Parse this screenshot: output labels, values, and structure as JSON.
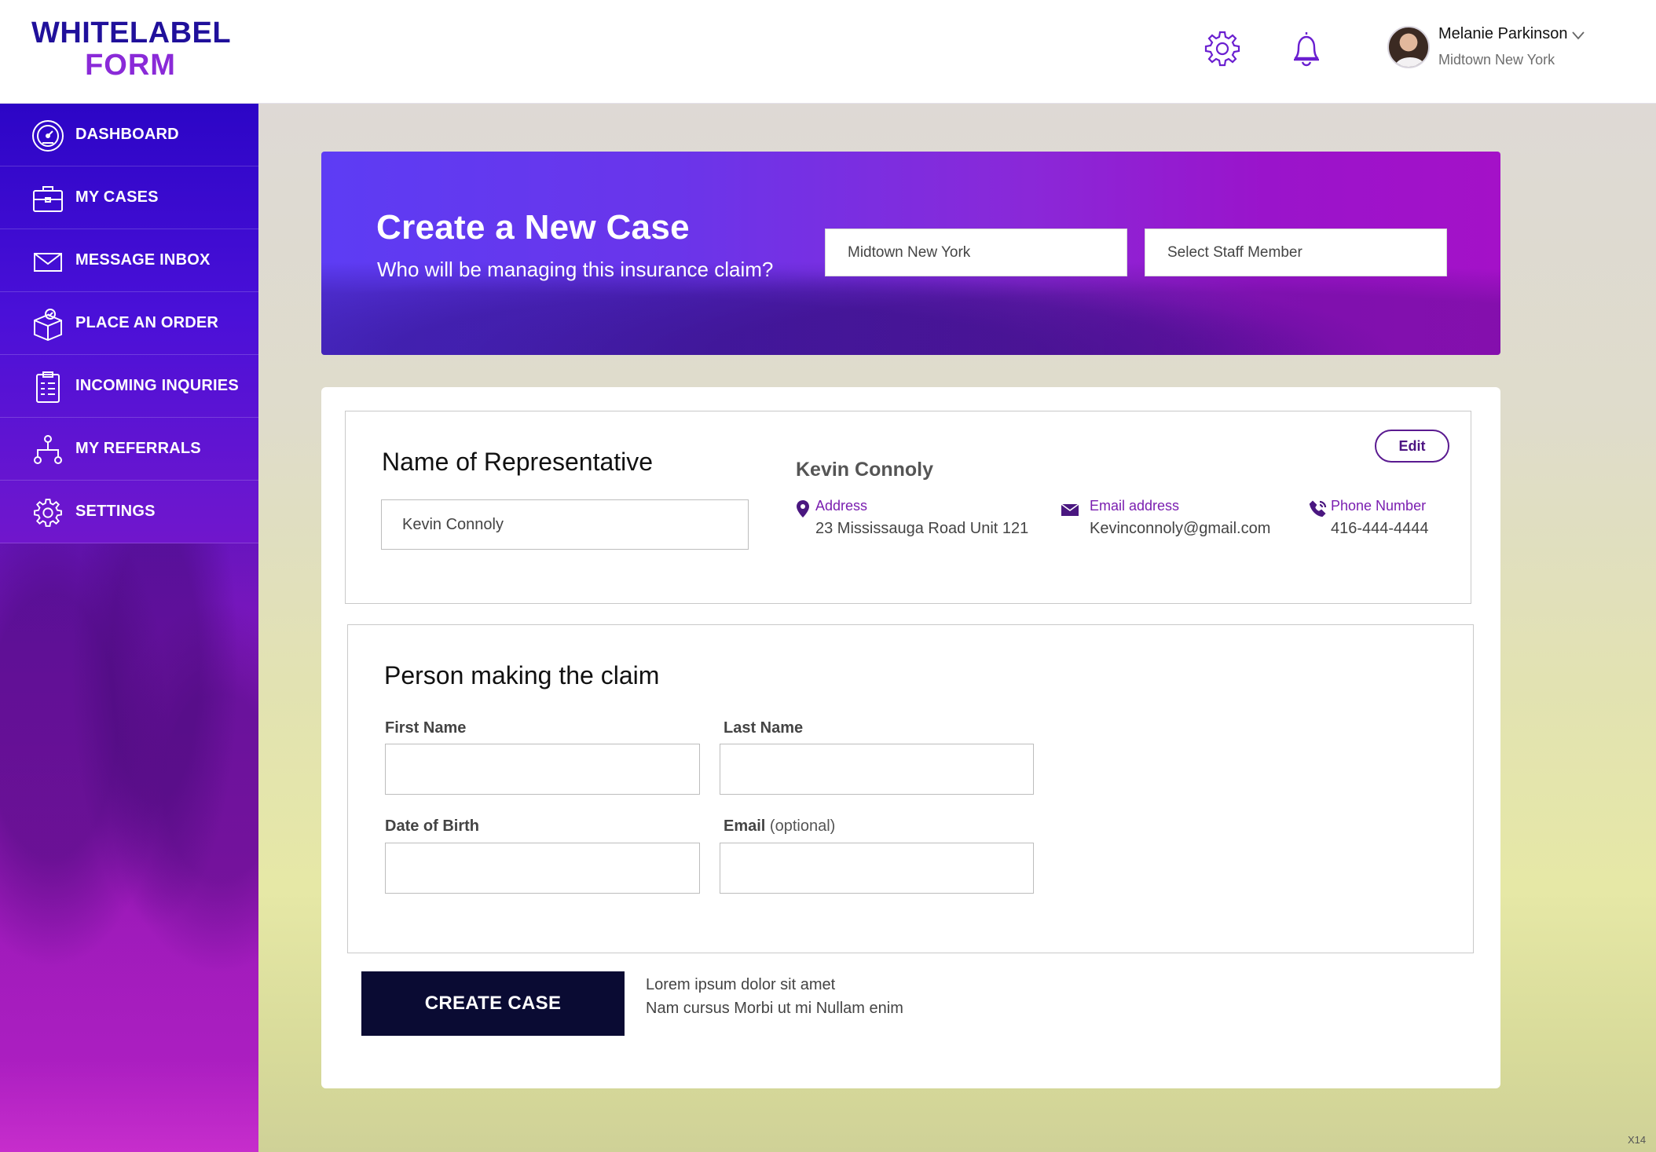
{
  "brand": {
    "line1": "WHITELABEL",
    "line2": "FORM"
  },
  "header": {
    "settings_icon": "gear-icon",
    "notifications_icon": "bell-icon",
    "user": {
      "name": "Melanie Parkinson",
      "location": "Midtown New York"
    }
  },
  "sidebar": {
    "items": [
      {
        "label": "DASHBOARD",
        "icon": "speedometer-icon"
      },
      {
        "label": "MY CASES",
        "icon": "briefcase-icon"
      },
      {
        "label": "MESSAGE INBOX",
        "icon": "envelope-icon"
      },
      {
        "label": "PLACE AN ORDER",
        "icon": "box-check-icon"
      },
      {
        "label": "INCOMING INQURIES",
        "icon": "clipboard-icon"
      },
      {
        "label": "MY REFERRALS",
        "icon": "network-icon"
      },
      {
        "label": "SETTINGS",
        "icon": "gear-icon"
      }
    ]
  },
  "banner": {
    "title": "Create a New Case",
    "subtitle": "Who will be managing this insurance claim?",
    "location_select": "Midtown New York",
    "staff_select": "Select Staff Member"
  },
  "representative": {
    "section_title": "Name of Representative",
    "input_value": "Kevin Connoly",
    "name": "Kevin Connoly",
    "edit_label": "Edit",
    "address_label": "Address",
    "address_value": "23 Mississauga Road Unit 121",
    "email_label": "Email address",
    "email_value": "Kevinconnoly@gmail.com",
    "phone_label": "Phone Number",
    "phone_value": "416-444-4444"
  },
  "claimant": {
    "section_title": "Person making the claim",
    "first_name_label": "First Name",
    "last_name_label": "Last Name",
    "dob_label": "Date of Birth",
    "email_label": "Email",
    "email_optional": "(optional)",
    "first_name_value": "",
    "last_name_value": "",
    "dob_value": "",
    "email_value": ""
  },
  "footer": {
    "create_label": "CREATE CASE",
    "note_line1": "Lorem ipsum dolor sit amet",
    "note_line2": "Nam cursus Morbi ut mi Nullam enim"
  },
  "corner_tag": "X14",
  "colors": {
    "brand_dark": "#20109b",
    "brand_light": "#8a2ad8",
    "accent_label": "#7a1eb0",
    "button_dark": "#0a0b33"
  }
}
